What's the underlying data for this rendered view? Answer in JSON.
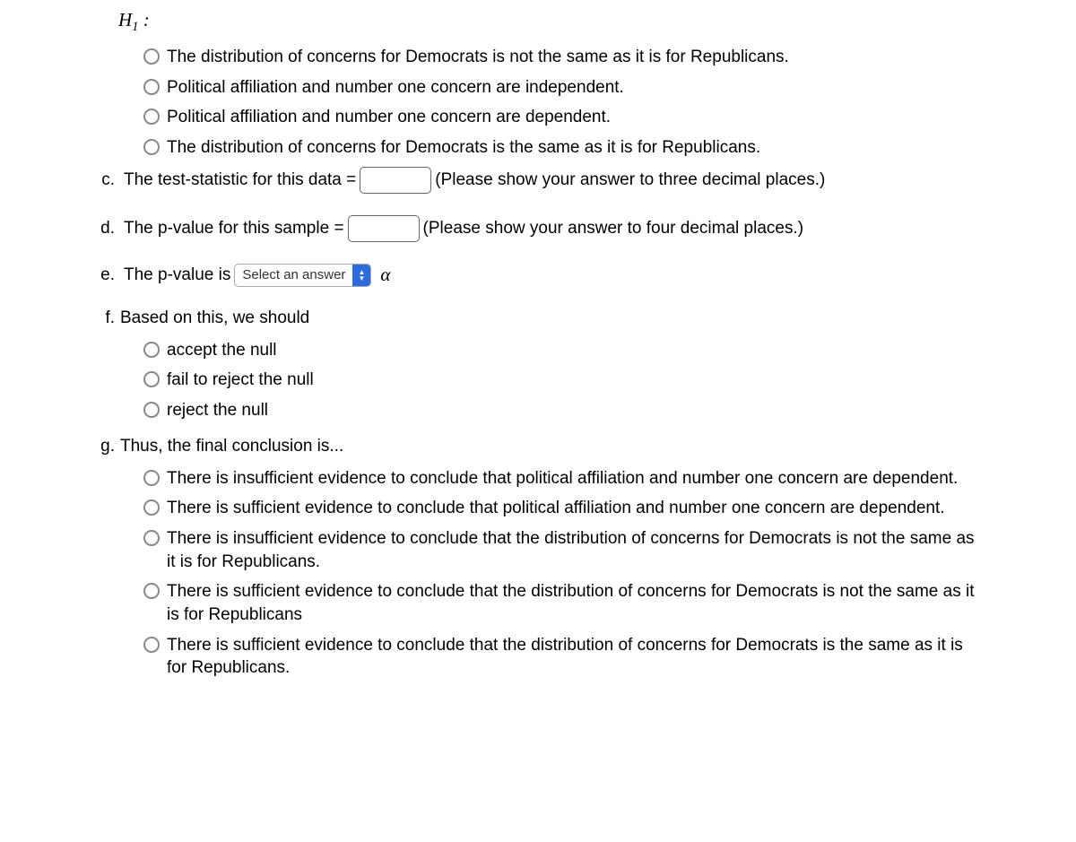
{
  "h1_label_html": "H₁ :",
  "h1_options": [
    "The distribution of concerns for Democrats is not the same as it is for Republicans.",
    "Political affiliation and number one concern are independent.",
    "Political affiliation and number one concern are dependent.",
    "The distribution of concerns for Democrats is the same as it is for Republicans."
  ],
  "c": {
    "marker": "c.",
    "before": "The test-statistic for this data =",
    "after": "(Please show your answer to three decimal places.)",
    "value": ""
  },
  "d": {
    "marker": "d.",
    "before": "The p-value for this sample =",
    "after": "(Please show your answer to four decimal places.)",
    "value": ""
  },
  "e": {
    "marker": "e.",
    "before": "The p-value is",
    "select_placeholder": "Select an answer",
    "alpha": "α"
  },
  "f": {
    "marker": "f.",
    "prompt": "Based on this, we should",
    "options": [
      "accept the null",
      "fail to reject the null",
      "reject the null"
    ]
  },
  "g": {
    "marker": "g.",
    "prompt": "Thus, the final conclusion is...",
    "options": [
      "There is insufficient evidence to conclude that political affiliation and number one concern are dependent.",
      "There is sufficient evidence to conclude that political affiliation and number one concern are dependent.",
      "There is insufficient evidence to conclude that the distribution of concerns for Democrats is not the same as it is for Republicans.",
      "There is sufficient evidence to conclude that the distribution of concerns for Democrats is not the same as it is for Republicans",
      "There is sufficient evidence to conclude that the distribution of concerns for Democrats is the same as it is for Republicans."
    ]
  }
}
